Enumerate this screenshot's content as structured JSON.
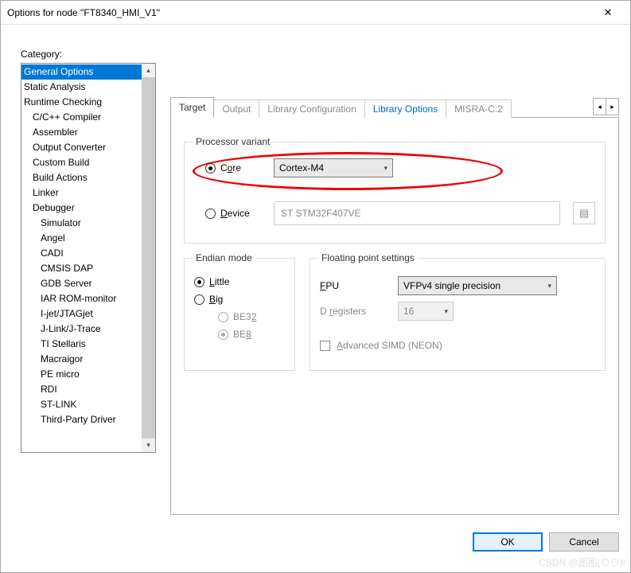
{
  "title": "Options for node \"FT8340_HMI_V1\"",
  "category_label": "Category:",
  "category_items": [
    {
      "label": "General Options",
      "indent": 0,
      "selected": true
    },
    {
      "label": "Static Analysis",
      "indent": 0
    },
    {
      "label": "Runtime Checking",
      "indent": 0
    },
    {
      "label": "C/C++ Compiler",
      "indent": 1
    },
    {
      "label": "Assembler",
      "indent": 1
    },
    {
      "label": "Output Converter",
      "indent": 1
    },
    {
      "label": "Custom Build",
      "indent": 1
    },
    {
      "label": "Build Actions",
      "indent": 1
    },
    {
      "label": "Linker",
      "indent": 1
    },
    {
      "label": "Debugger",
      "indent": 1
    },
    {
      "label": "Simulator",
      "indent": 2
    },
    {
      "label": "Angel",
      "indent": 2
    },
    {
      "label": "CADI",
      "indent": 2
    },
    {
      "label": "CMSIS DAP",
      "indent": 2
    },
    {
      "label": "GDB Server",
      "indent": 2
    },
    {
      "label": "IAR ROM-monitor",
      "indent": 2
    },
    {
      "label": "I-jet/JTAGjet",
      "indent": 2
    },
    {
      "label": "J-Link/J-Trace",
      "indent": 2
    },
    {
      "label": "TI Stellaris",
      "indent": 2
    },
    {
      "label": "Macraigor",
      "indent": 2
    },
    {
      "label": "PE micro",
      "indent": 2
    },
    {
      "label": "RDI",
      "indent": 2
    },
    {
      "label": "ST-LINK",
      "indent": 2
    },
    {
      "label": "Third-Party Driver",
      "indent": 2
    }
  ],
  "tabs": {
    "target": "Target",
    "output": "Output",
    "libconf": "Library Configuration",
    "libopt": "Library Options",
    "misra": "MISRA-C:2"
  },
  "proc": {
    "legend": "Processor variant",
    "core_label_pre": "C",
    "core_label_ul": "o",
    "core_label_post": "re",
    "core_value": "Cortex-M4",
    "device_label_ul": "D",
    "device_label_post": "evice",
    "device_value": "ST STM32F407VE"
  },
  "endian": {
    "legend": "Endian mode",
    "little_ul": "L",
    "little_post": "ittle",
    "big_ul": "B",
    "big_post": "ig",
    "be32_pre": "BE3",
    "be32_ul": "2",
    "be8_pre": "BE",
    "be8_ul": "8"
  },
  "fp": {
    "legend": "Floating point settings",
    "fpu_ul": "F",
    "fpu_post": "PU",
    "fpu_value": "VFPv4 single precision",
    "dreg_pre": "D ",
    "dreg_ul": "r",
    "dreg_post": "egisters",
    "dreg_value": "16",
    "neon_ul": "A",
    "neon_post": "dvanced SIMD (NEON)"
  },
  "buttons": {
    "ok": "OK",
    "cancel": "Cancel"
  },
  "watermark": "CSDN @图图(⊙⊙)!"
}
